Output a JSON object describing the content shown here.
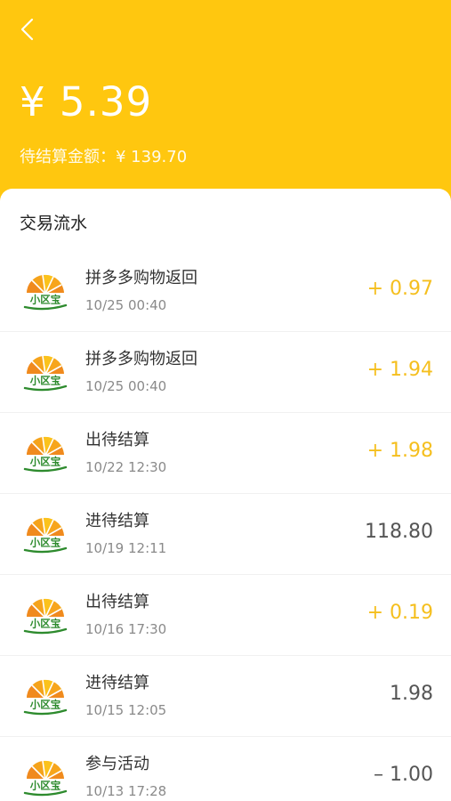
{
  "header": {
    "back_icon": "chevron-left-icon",
    "balance": "¥ 5.39",
    "pending_label": "待结算金额：¥ 139.70"
  },
  "section": {
    "title": "交易流水"
  },
  "transactions": [
    {
      "title": "拼多多购物返回",
      "time": "10/25 00:40",
      "amount": "+ 0.97",
      "kind": "pos"
    },
    {
      "title": "拼多多购物返回",
      "time": "10/25 00:40",
      "amount": "+ 1.94",
      "kind": "pos"
    },
    {
      "title": "出待结算",
      "time": "10/22 12:30",
      "amount": "+ 1.98",
      "kind": "pos"
    },
    {
      "title": "进待结算",
      "time": "10/19 12:11",
      "amount": "118.80",
      "kind": "neu"
    },
    {
      "title": "出待结算",
      "time": "10/16 17:30",
      "amount": "+ 0.19",
      "kind": "pos"
    },
    {
      "title": "进待结算",
      "time": "10/15 12:05",
      "amount": "1.98",
      "kind": "neu"
    },
    {
      "title": "参与活动",
      "time": "10/13 17:28",
      "amount": "– 1.00",
      "kind": "neu"
    }
  ],
  "logo": {
    "text": "小区宝",
    "icon": "xiaoqubao-logo-icon"
  },
  "colors": {
    "brand": "#FFC70F",
    "positive": "#F5BF1E",
    "neutral": "#555555"
  }
}
